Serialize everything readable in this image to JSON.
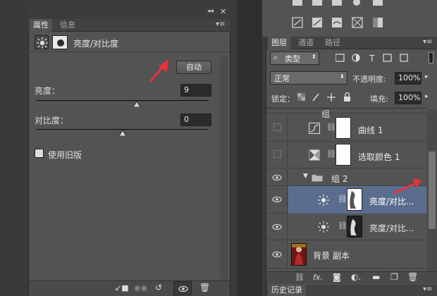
{
  "properties_panel": {
    "tabs": [
      {
        "label": "属性",
        "active": true
      },
      {
        "label": "信息",
        "active": false
      }
    ],
    "title": "亮度/对比度",
    "auto_button": "自动",
    "brightness": {
      "label": "亮度：",
      "value": "9",
      "slider_fraction": 0.58
    },
    "contrast": {
      "label": "对比度：",
      "value": "0",
      "slider_fraction": 0.5
    },
    "legacy": {
      "label": "使用旧版",
      "checked": false
    },
    "icons": [
      "sun-adjustment-icon",
      "mask-icon",
      "clip-to-layer-icon",
      "view-previous-icon",
      "reset-icon",
      "visibility-icon",
      "delete-icon"
    ]
  },
  "layers_panel": {
    "tabs": [
      {
        "label": "图层",
        "active": true
      },
      {
        "label": "通道",
        "active": false
      },
      {
        "label": "路径",
        "active": false
      }
    ],
    "filter_kind": "类型",
    "blend_mode": "正常",
    "opacity_label": "不透明度:",
    "opacity_value": "100%",
    "lock_label": "锁定：",
    "fill_label": "填充:",
    "fill_value": "100%",
    "partial_top_label": "组",
    "layers": [
      {
        "name": "曲线 1",
        "type": "curves",
        "visible": false,
        "selected": false,
        "indent": 0
      },
      {
        "name": "选取颜色 1",
        "type": "selective-color",
        "visible": false,
        "selected": false,
        "indent": 0
      },
      {
        "name": "组 2",
        "type": "group",
        "visible": true,
        "selected": false,
        "indent": 0
      },
      {
        "name": "亮度/对比...",
        "type": "brightness",
        "visible": true,
        "selected": true,
        "indent": 1
      },
      {
        "name": "亮度/对比...",
        "type": "brightness",
        "visible": true,
        "selected": false,
        "indent": 1
      },
      {
        "name": "背景 副本",
        "type": "photo",
        "visible": true,
        "selected": false,
        "indent": 0
      }
    ]
  },
  "history_tab": "历史记录",
  "colors": {
    "panel": "#535353",
    "selected_row": "#5a6d8f",
    "arrow": "#e8333a"
  }
}
